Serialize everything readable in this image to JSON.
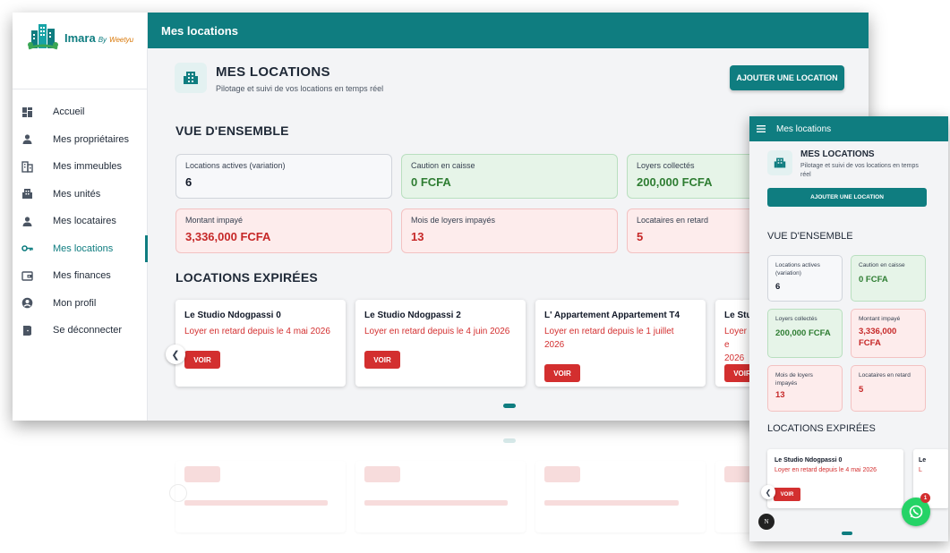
{
  "brand": {
    "name": "Imara",
    "by": "By",
    "company": "Weetyu"
  },
  "topbar": {
    "title": "Mes locations"
  },
  "sidebar": {
    "items": [
      {
        "label": "Accueil",
        "icon": "dashboard-icon"
      },
      {
        "label": "Mes propriétaires",
        "icon": "person-icon"
      },
      {
        "label": "Mes immeubles",
        "icon": "building-icon"
      },
      {
        "label": "Mes unités",
        "icon": "apartment-icon"
      },
      {
        "label": "Mes locataires",
        "icon": "person-icon"
      },
      {
        "label": "Mes locations",
        "icon": "key-icon",
        "active": true
      },
      {
        "label": "Mes finances",
        "icon": "wallet-icon"
      },
      {
        "label": "Mon profil",
        "icon": "account-circle-icon"
      },
      {
        "label": "Se déconnecter",
        "icon": "logout-door-icon"
      }
    ]
  },
  "header": {
    "title": "MES LOCATIONS",
    "subtitle": "Pilotage et suivi de vos locations en temps réel",
    "add_button": "AJOUTER UNE LOCATION"
  },
  "overview": {
    "title": "VUE D'ENSEMBLE",
    "stats": [
      {
        "label": "Locations actives (variation)",
        "value": "6",
        "tone": "neutral"
      },
      {
        "label": "Caution en caisse",
        "value": "0 FCFA",
        "tone": "green"
      },
      {
        "label": "Loyers collectés",
        "value": "200,000 FCFA",
        "tone": "green"
      },
      {
        "label": "Montant impayé",
        "value": "3,336,000 FCFA",
        "tone": "red"
      },
      {
        "label": "Mois de loyers impayés",
        "value": "13",
        "tone": "red"
      },
      {
        "label": "Locataires en retard",
        "value": "5",
        "tone": "red"
      }
    ]
  },
  "expired": {
    "title": "LOCATIONS EXPIRÉES",
    "view_label": "VOIR",
    "cards": [
      {
        "name": "Le Studio Ndogpassi 0",
        "late": "Loyer en retard depuis le 4 mai 2026"
      },
      {
        "name": "Le Studio Ndogpassi 2",
        "late": "Loyer en retard depuis le 4 juin 2026"
      },
      {
        "name": "L' Appartement Appartement T4",
        "late": "Loyer en retard depuis le 1 juillet 2026"
      },
      {
        "name": "Le Stu",
        "late": "Loyer e 2026"
      }
    ]
  },
  "mobile": {
    "title": "Mes locations",
    "second_card_name": "Le",
    "second_card_late": "L",
    "avatar_letter": "N",
    "whatsapp_badge": "1"
  },
  "colors": {
    "primary": "#0f7d80",
    "danger": "#d32f2f",
    "success": "#2e7d32"
  }
}
